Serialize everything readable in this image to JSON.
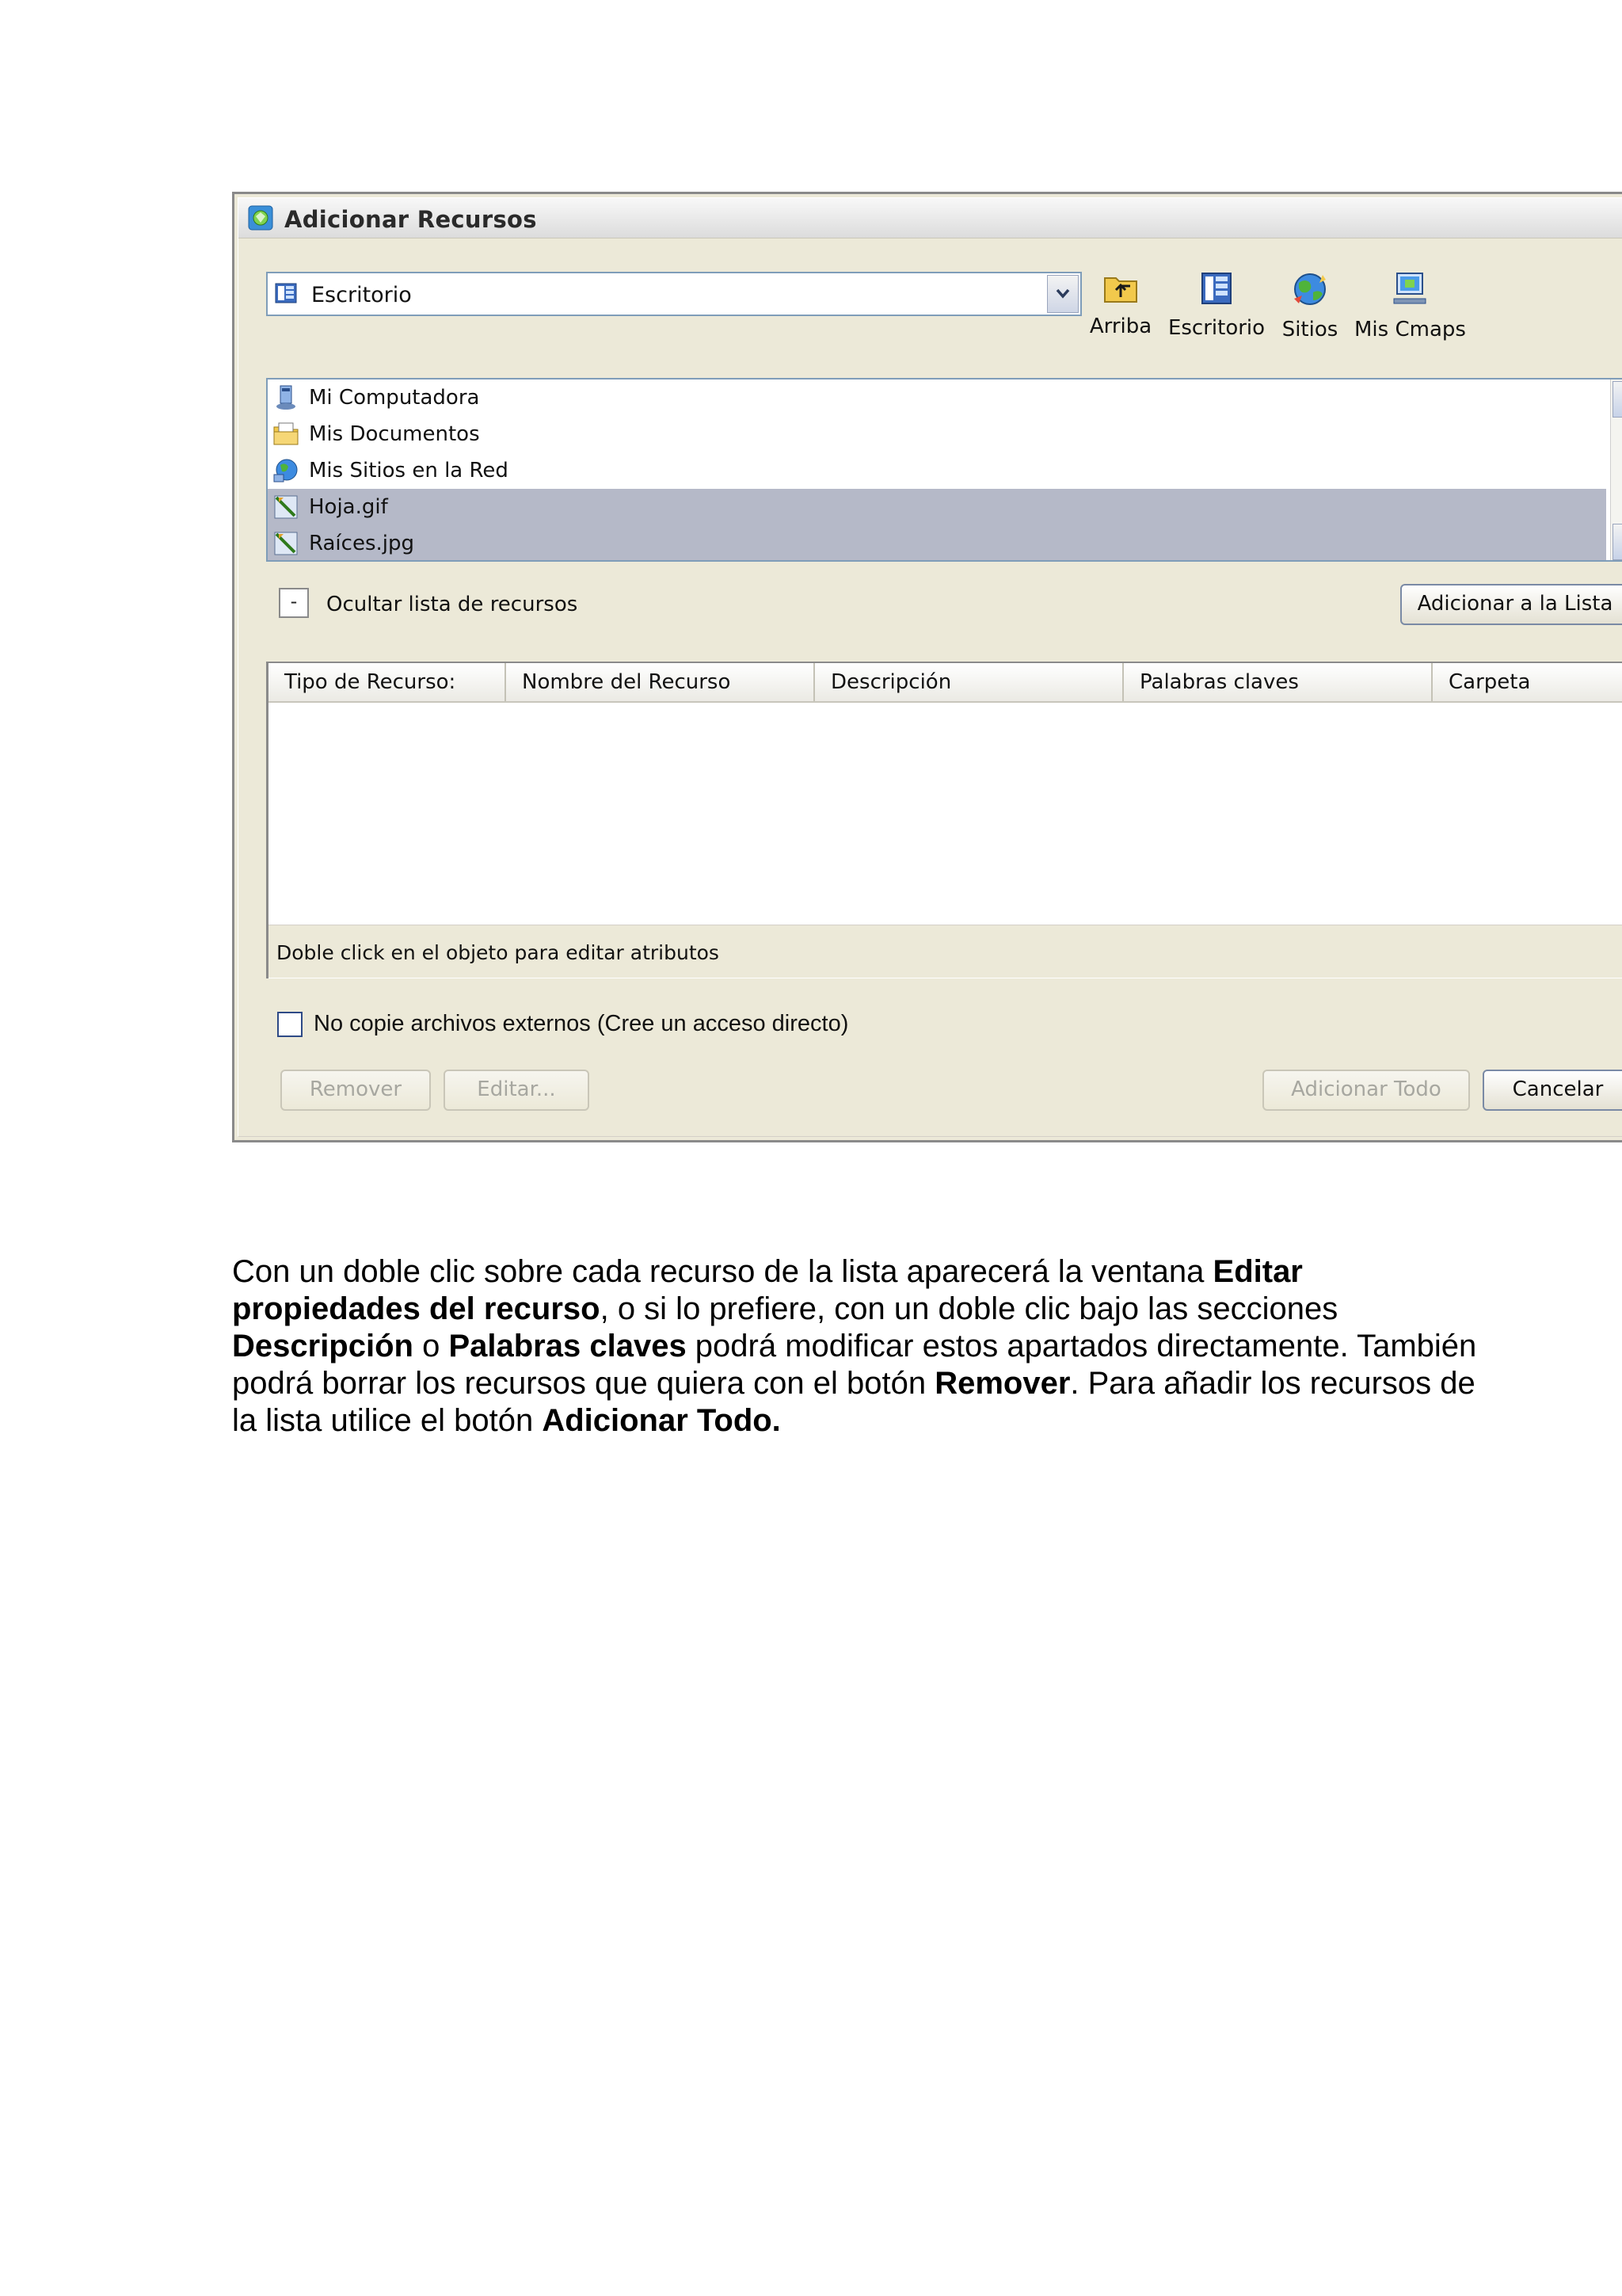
{
  "dialog": {
    "title": "Adicionar Recursos",
    "location": {
      "value": "Escritorio"
    },
    "toolbar": [
      {
        "label": "Arriba",
        "icon": "folder-up-icon"
      },
      {
        "label": "Escritorio",
        "icon": "desktop-icon"
      },
      {
        "label": "Sitios",
        "icon": "globe-icon"
      },
      {
        "label": "Mis Cmaps",
        "icon": "computer-icon"
      }
    ],
    "files": [
      {
        "name": "Mi Computadora",
        "icon": "computer-icon",
        "selected": false
      },
      {
        "name": "Mis Documentos",
        "icon": "documents-icon",
        "selected": false
      },
      {
        "name": "Mis Sitios en la Red",
        "icon": "network-icon",
        "selected": false
      },
      {
        "name": "Hoja.gif",
        "icon": "image-file-icon",
        "selected": true
      },
      {
        "name": "Raíces.jpg",
        "icon": "image-file-icon",
        "selected": true
      }
    ],
    "hide_toggle": {
      "symbol": "-",
      "label": "Ocultar lista de recursos"
    },
    "add_to_list_label": "Adicionar a la Lista",
    "table": {
      "columns": [
        "Tipo de Recurso:",
        "Nombre del Recurso",
        "Descripción",
        "Palabras claves",
        "Carpeta"
      ],
      "rows": [],
      "footer": "Doble click en el objeto para editar atributos"
    },
    "no_copy_checkbox": {
      "label": "No copie archivos externos (Cree un acceso directo)",
      "checked": false
    },
    "buttons": {
      "remove": "Remover",
      "edit": "Editar...",
      "add_all": "Adicionar Todo",
      "cancel": "Cancelar"
    }
  },
  "paragraph": {
    "p1": "Con un doble clic sobre cada recurso de la lista aparecerá la ventana ",
    "b1": "Editar propiedades del recurso",
    "p2": ", o si lo prefiere, con un doble clic bajo las secciones ",
    "b2": "Descripción",
    "p3": " o ",
    "b3": "Palabras claves",
    "p4": " podrá modificar estos apartados directamente. También podrá borrar  los recursos que quiera con el botón ",
    "b4": "Remover",
    "p5": ". Para añadir los recursos de la lista utilice el botón ",
    "b5": "Adicionar Todo."
  }
}
